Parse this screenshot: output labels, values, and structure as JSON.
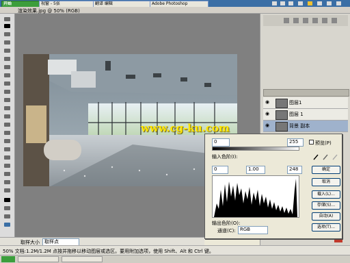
{
  "taskbar": {
    "tabs": [
      "开始",
      "视窗 - 5张",
      "翻译 编辑",
      "Adobe Photoshop"
    ]
  },
  "document": {
    "title": "渲染效果.jpg @ 50% (RGB)"
  },
  "photo": {
    "watermark": "www.cg-ku.com"
  },
  "layers": {
    "rows": [
      {
        "name": "图层1",
        "selected": false
      },
      {
        "name": "图层 1",
        "selected": false
      },
      {
        "name": "背景 副本",
        "selected": true
      }
    ]
  },
  "levels": {
    "input_black": "0",
    "input_white": "255",
    "section_label": "输入色阶(I):",
    "input_low": "0",
    "gamma": "1.00",
    "input_high": "248",
    "output_label": "输出色阶(O):",
    "channel_label": "通道(C):",
    "channel_value": "RGB",
    "preview_label": "预览(P)",
    "buttons": [
      "确定",
      "取消",
      "载入(L)...",
      "存储(S)...",
      "自动(A)",
      "选项(T)..."
    ]
  },
  "options_bar": {
    "mode_label": "取样大小",
    "mode_value": "取样点"
  },
  "status": {
    "text": "50% 文档:1.2M/1.2M 点按并拖移以移动图层或选区。要用附加选项，使用 Shift、Alt 和 Ctrl 键。"
  },
  "colors": {
    "accent": "#3a6ea5",
    "watermark": "#ffe600",
    "selected_layer": "#9fb2cc"
  }
}
